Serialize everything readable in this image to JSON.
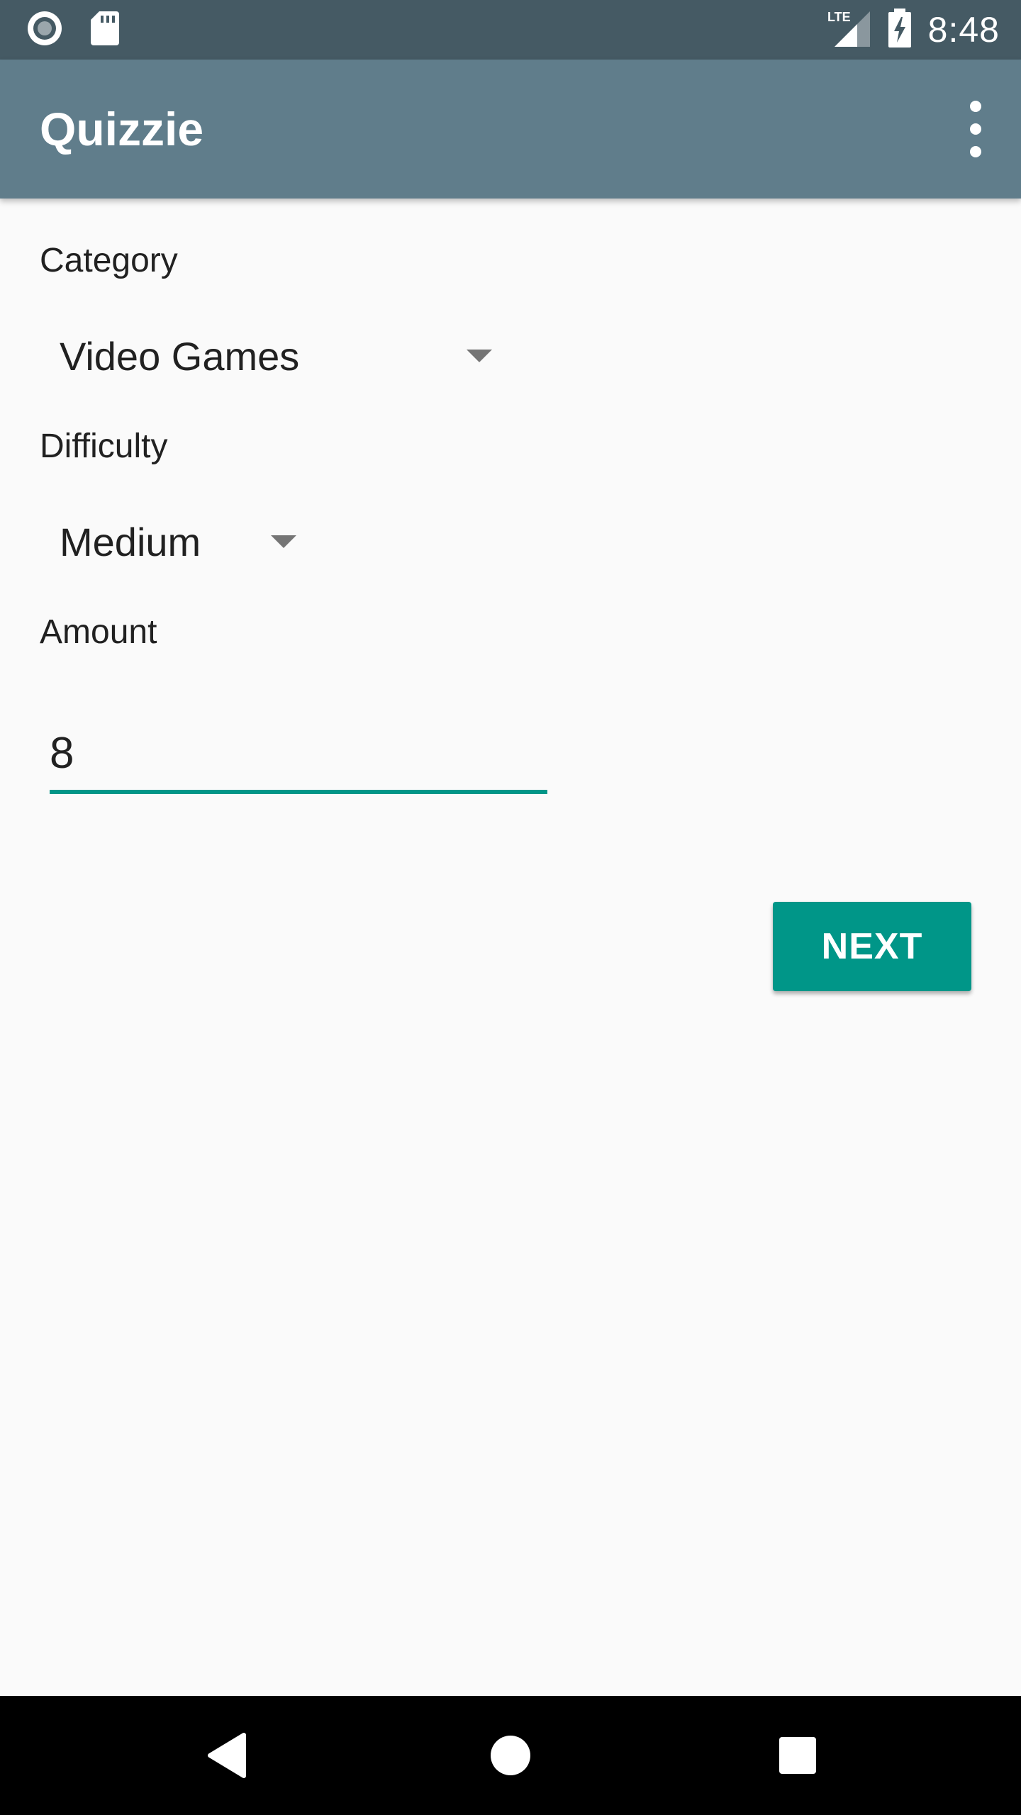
{
  "status_bar": {
    "time": "8:48",
    "network": "LTE",
    "icons": [
      "circle-record-icon",
      "sd-card-icon",
      "lte-signal-icon",
      "battery-charging-icon"
    ]
  },
  "app_bar": {
    "title": "Quizzie",
    "menu_icon": "more-vert-icon"
  },
  "form": {
    "category": {
      "label": "Category",
      "selected": "Video Games"
    },
    "difficulty": {
      "label": "Difficulty",
      "selected": "Medium"
    },
    "amount": {
      "label": "Amount",
      "value": "8"
    },
    "next_label": "NEXT"
  },
  "nav_bar": {
    "icons": [
      "back-icon",
      "home-icon",
      "recents-icon"
    ]
  },
  "colors": {
    "status_bar": "#455a64",
    "app_bar": "#607d8b",
    "accent": "#009688",
    "background": "#fafafa"
  }
}
